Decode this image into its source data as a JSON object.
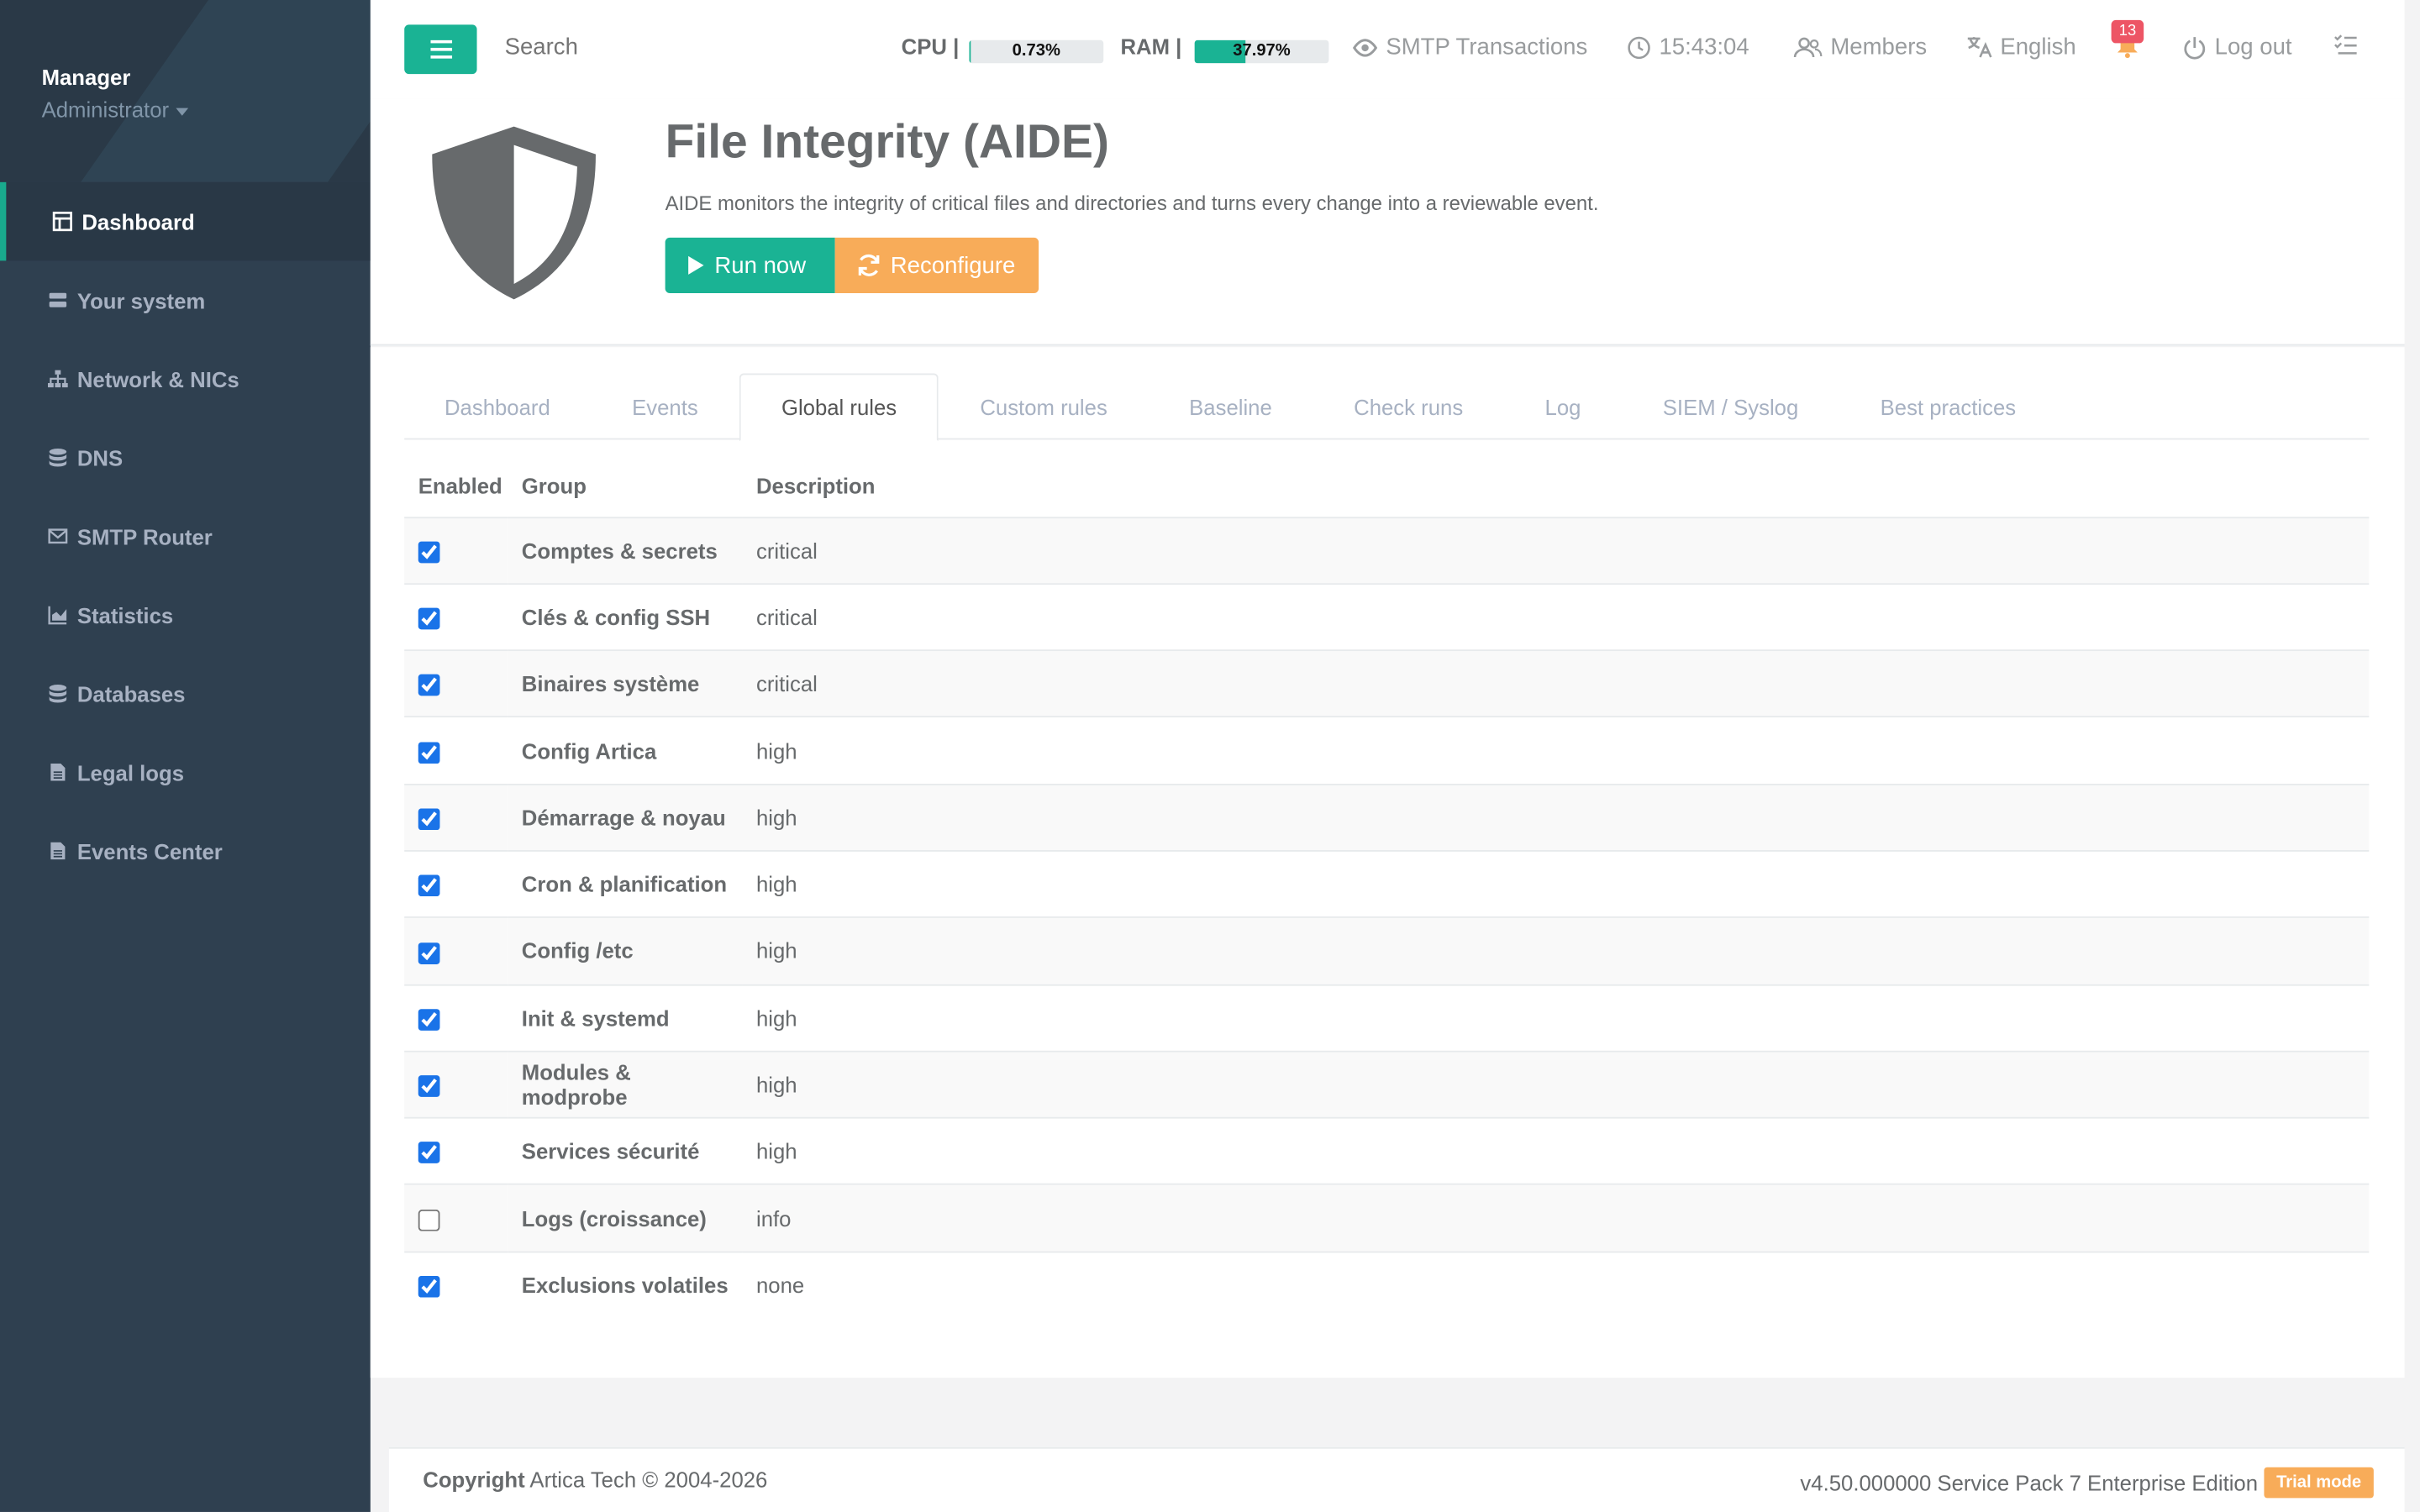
{
  "sidebar": {
    "user_name": "Manager",
    "user_role": "Administrator",
    "items": [
      {
        "label": "Dashboard",
        "icon": "dashboard-icon"
      },
      {
        "label": "Your system",
        "icon": "server-icon"
      },
      {
        "label": "Network & NICs",
        "icon": "sitemap-icon"
      },
      {
        "label": "DNS",
        "icon": "database-icon"
      },
      {
        "label": "SMTP Router",
        "icon": "envelope-icon"
      },
      {
        "label": "Statistics",
        "icon": "chart-icon"
      },
      {
        "label": "Databases",
        "icon": "database-icon"
      },
      {
        "label": "Legal logs",
        "icon": "file-icon"
      },
      {
        "label": "Events Center",
        "icon": "file-icon"
      }
    ],
    "active_index": 0
  },
  "topbar": {
    "search_placeholder": "Search",
    "cpu_label": "CPU",
    "cpu_value": "0.73%",
    "cpu_percent": 0.73,
    "ram_label": "RAM",
    "ram_value": "37.97%",
    "ram_percent": 37.97,
    "smtp_label": "SMTP Transactions",
    "clock": "15:43:04",
    "members_label": "Members",
    "language_label": "English",
    "notifications_count": "13",
    "logout_label": "Log out"
  },
  "header": {
    "title": "File Integrity (AIDE)",
    "subtitle": "AIDE monitors the integrity of critical files and directories and turns every change into a reviewable event.",
    "run_now_label": "Run now",
    "reconfigure_label": "Reconfigure"
  },
  "tabs": [
    "Dashboard",
    "Events",
    "Global rules",
    "Custom rules",
    "Baseline",
    "Check runs",
    "Log",
    "SIEM / Syslog",
    "Best practices"
  ],
  "active_tab": "Global rules",
  "table": {
    "columns": [
      "Enabled",
      "Group",
      "Description"
    ],
    "rows": [
      {
        "enabled": true,
        "group": "Comptes & secrets",
        "description": "critical"
      },
      {
        "enabled": true,
        "group": "Clés & config SSH",
        "description": "critical"
      },
      {
        "enabled": true,
        "group": "Binaires système",
        "description": "critical"
      },
      {
        "enabled": true,
        "group": "Config Artica",
        "description": "high"
      },
      {
        "enabled": true,
        "group": "Démarrage & noyau",
        "description": "high"
      },
      {
        "enabled": true,
        "group": "Cron & planification",
        "description": "high"
      },
      {
        "enabled": true,
        "group": "Config /etc",
        "description": "high"
      },
      {
        "enabled": true,
        "group": "Init & systemd",
        "description": "high"
      },
      {
        "enabled": true,
        "group": "Modules & modprobe",
        "description": "high"
      },
      {
        "enabled": true,
        "group": "Services sécurité",
        "description": "high"
      },
      {
        "enabled": false,
        "group": "Logs (croissance)",
        "description": "info"
      },
      {
        "enabled": true,
        "group": "Exclusions volatiles",
        "description": "none"
      }
    ]
  },
  "footer": {
    "copyright_label": "Copyright",
    "copyright_text": "Artica Tech © 2004-2026",
    "version": "v4.50.000000 Service Pack 7 Enterprise Edition",
    "trial_badge": "Trial mode"
  },
  "colors": {
    "accent": "#1ab394",
    "warning": "#f8ac59",
    "danger": "#ed5565",
    "sidebar_bg": "#2f4050"
  }
}
